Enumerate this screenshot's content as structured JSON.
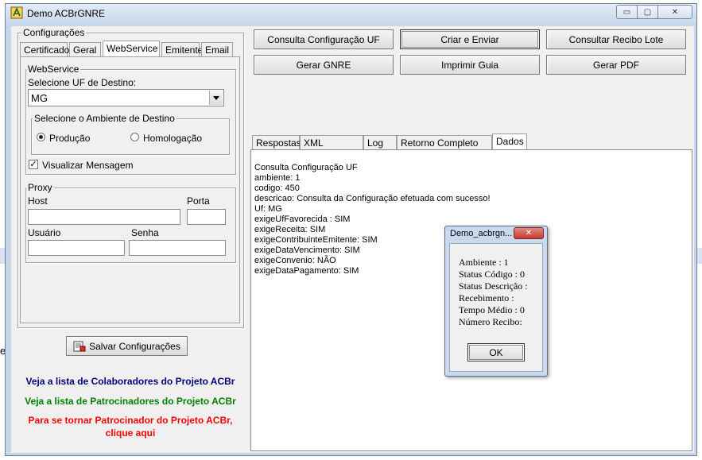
{
  "window": {
    "title": "Demo ACBrGNRE"
  },
  "caption_buttons": {
    "minimize": "▭",
    "maximize": "▢",
    "close": "✕"
  },
  "config": {
    "group_label": "Configurações",
    "tabs": [
      {
        "label": "Certificado",
        "active": false
      },
      {
        "label": "Geral",
        "active": false
      },
      {
        "label": "WebService",
        "active": true
      },
      {
        "label": "Emitente",
        "active": false
      },
      {
        "label": "Email",
        "active": false
      }
    ],
    "webservice": {
      "group_label": "WebService",
      "uf_label": "Selecione UF de Destino:",
      "uf_value": "MG",
      "ambiente_group_label": "Selecione o Ambiente de Destino",
      "radio_producao": "Produção",
      "radio_homologacao": "Homologação",
      "selected_ambiente": "Produção",
      "visualizar_label": "Visualizar Mensagem",
      "visualizar_checked": true
    },
    "proxy": {
      "group_label": "Proxy",
      "host_label": "Host",
      "porta_label": "Porta",
      "usuario_label": "Usuário",
      "senha_label": "Senha",
      "host_value": "",
      "porta_value": "",
      "usuario_value": "",
      "senha_value": ""
    },
    "save_button": "Salvar Configurações"
  },
  "links": {
    "colaboradores": "Veja a lista de Colaboradores do Projeto ACBr",
    "patrocinadores": "Veja a lista de Patrocinadores do Projeto ACBr",
    "patrocinador_line1": "Para se tornar Patrocinador do Projeto ACBr,",
    "patrocinador_line2": "clique aqui",
    "colors": {
      "colaboradores": "#000080",
      "patrocinadores": "#008000",
      "patrocinador": "#ff0000"
    }
  },
  "actions": {
    "consulta_config_uf": "Consulta Configuração UF",
    "criar_enviar": "Criar e Enviar",
    "consultar_recibo_lote": "Consultar Recibo Lote",
    "gerar_gnre": "Gerar GNRE",
    "imprimir_guia": "Imprimir Guia",
    "gerar_pdf": "Gerar PDF"
  },
  "result_tabs": [
    {
      "label": "Respostas",
      "active": false
    },
    {
      "label": "XML Resposta",
      "active": false
    },
    {
      "label": "Log",
      "active": false
    },
    {
      "label": "Retorno Completo WS",
      "active": false
    },
    {
      "label": "Dados",
      "active": true
    }
  ],
  "memo_lines": [
    "Consulta Configuração UF",
    "ambiente: 1",
    "codigo: 450",
    "descricao: Consulta da Configuração efetuada com sucesso!",
    "Uf: MG",
    "exigeUfFavorecida : SIM",
    "exigeReceita: SIM",
    "exigeContribuinteEmitente: SIM",
    "exigeDataVencimento: SIM",
    "exigeConvenio: NÃO",
    "exigeDataPagamento: SIM"
  ],
  "dialog": {
    "title": "Demo_acbrgn...",
    "close": "✕",
    "lines": [
      "Ambiente : 1",
      "Status Código : 0",
      "Status Descrição :",
      "Recebimento :",
      "Tempo Médio : 0",
      "Número Recibo:"
    ],
    "ok_button": "OK"
  },
  "stray_text": "e",
  "colors": {
    "window_frame": "#c7d6ea",
    "client": "#f0f0f0",
    "close_button": "#c9463d"
  }
}
